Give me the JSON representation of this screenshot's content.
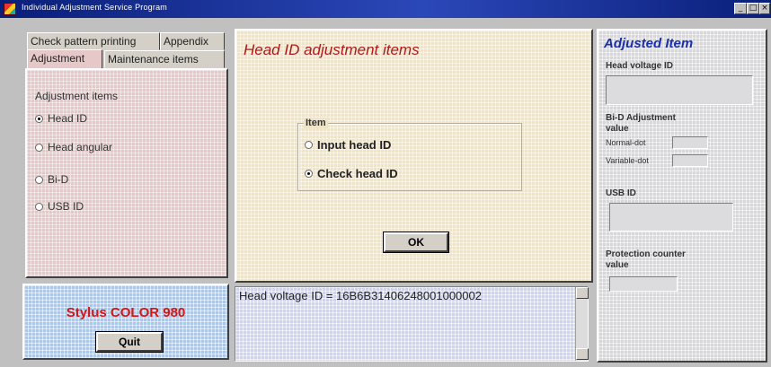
{
  "window": {
    "title": "Individual Adjustment Service Program",
    "controls": [
      "_",
      "□",
      "×"
    ]
  },
  "tabs": {
    "row1": [
      "Check pattern printing",
      "Appendix"
    ],
    "row2": [
      "Adjustment",
      "Maintenance items"
    ],
    "active": "Adjustment"
  },
  "adjustment_items": {
    "heading": "Adjustment items",
    "options": [
      {
        "label": "Head ID",
        "selected": true
      },
      {
        "label": "Head angular",
        "selected": false
      },
      {
        "label": "Bi-D",
        "selected": false
      },
      {
        "label": "USB ID",
        "selected": false
      }
    ]
  },
  "product": {
    "name": "Stylus COLOR 980",
    "quit_label": "Quit",
    "name_color": "#d01818"
  },
  "center": {
    "title": "Head ID adjustment items",
    "title_color": "#b01818",
    "item_group": "Item",
    "options": [
      {
        "label": "Input head ID",
        "selected": false
      },
      {
        "label": "Check head ID",
        "selected": true
      }
    ],
    "ok_label": "OK"
  },
  "output": {
    "text": "Head voltage ID = 16B6B31406248001000002"
  },
  "adjusted_item": {
    "title": "Adjusted Item",
    "title_color": "#1a2fa8",
    "head_voltage_label": "Head voltage ID",
    "bid_label_1": "Bi-D Adjustment",
    "bid_label_2": "value",
    "normal_dot": "Normal-dot",
    "variable_dot": "Variable-dot",
    "usb_label": "USB ID",
    "protection_label_1": "Protection counter",
    "protection_label_2": "value"
  }
}
